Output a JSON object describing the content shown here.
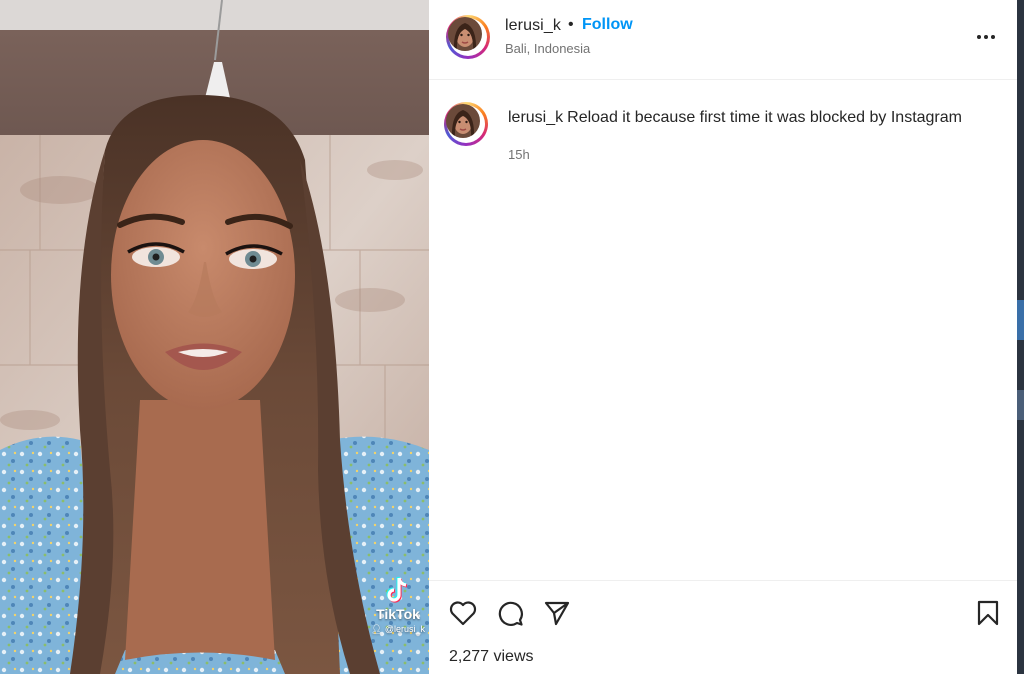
{
  "post": {
    "username": "lerusi_k",
    "separator": "•",
    "follow_label": "Follow",
    "location": "Bali, Indonesia",
    "more_icon": "more-horizontal-icon",
    "caption_username": "lerusi_k",
    "caption_text": "Reload it because first time it was blocked by Instagram",
    "time_ago": "15h",
    "views": "2,277 views"
  },
  "media": {
    "watermark_brand": "TikTok",
    "watermark_user": "@lerusi_k"
  },
  "actions": {
    "like_icon": "heart-icon",
    "comment_icon": "comment-icon",
    "share_icon": "share-icon",
    "save_icon": "bookmark-icon"
  },
  "colors": {
    "follow_blue": "#0095f6",
    "secondary_text": "#737373",
    "primary_text": "#262626",
    "divider": "#efefef"
  }
}
